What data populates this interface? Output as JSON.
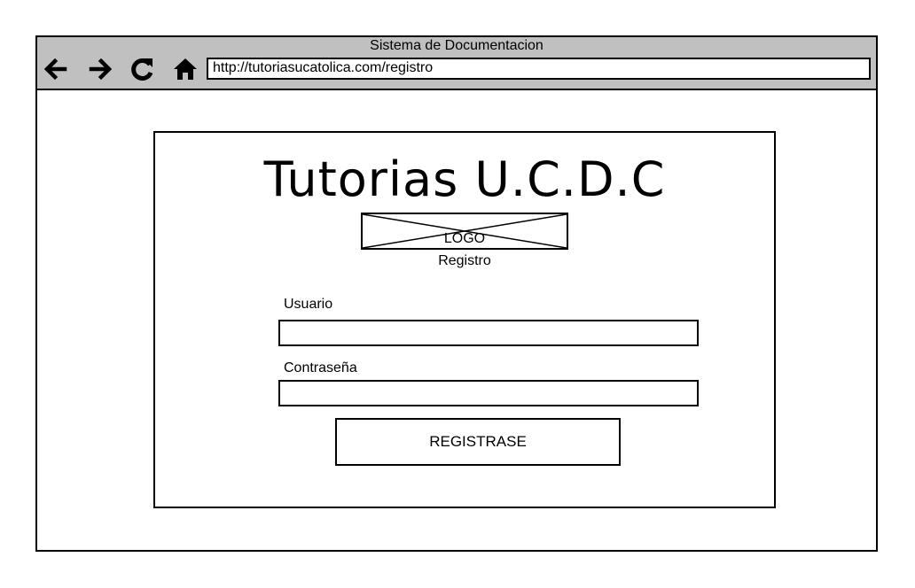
{
  "window": {
    "title": "Sistema de Documentacion"
  },
  "navigation": {
    "back_icon": "arrow-left-icon",
    "forward_icon": "arrow-right-icon",
    "reload_icon": "reload-icon",
    "home_icon": "home-icon",
    "url": "http://tutoriasucatolica.com/registro"
  },
  "form": {
    "app_title": "Tutorias U.C.D.C",
    "logo_label": "LOGO",
    "subtitle": "Registro",
    "username_label": "Usuario",
    "username_value": "",
    "password_label": "Contraseña",
    "password_value": "",
    "submit_label": "REGISTRASE"
  },
  "colors": {
    "titlebar": "#c0c0c0",
    "border": "#000000",
    "background": "#ffffff"
  }
}
